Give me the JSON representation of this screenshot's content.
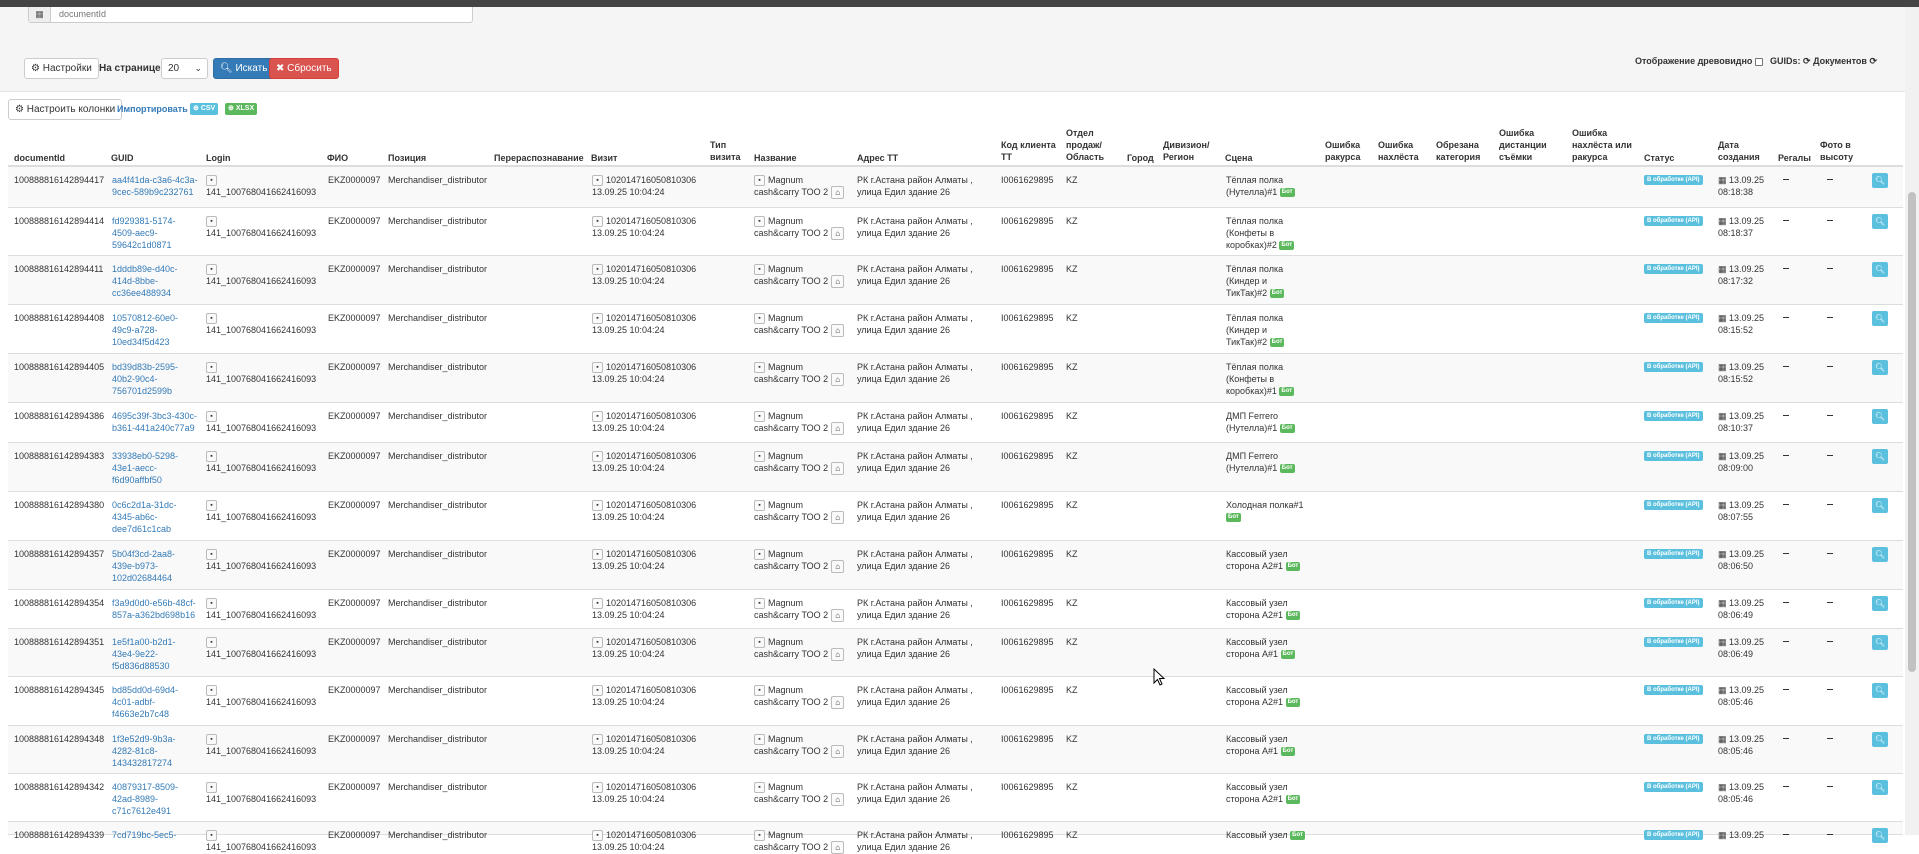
{
  "filters": {
    "document_id_placeholder": "documentId",
    "settings_label": "Настройки",
    "per_page_label": "На странице:",
    "per_page_value": "20",
    "search_label": "Искать",
    "reset_label": "Сбросить",
    "tree_view_label": "Отображение древовидно",
    "guids_label": "GUIDs:",
    "documents_label": "Документов"
  },
  "toolbar": {
    "configure_columns_label": "Настроить колонки",
    "import_label": "Импортировать",
    "csv_label": "CSV",
    "xlsx_label": "XLSX"
  },
  "columns": {
    "documentId": "documentId",
    "guid": "GUID",
    "login": "Login",
    "fio": "ФИО",
    "position": "Позиция",
    "rerecog": "Перераспознавание",
    "visit": "Визит",
    "visit_type": "Тип визита",
    "name": "Название",
    "address": "Адрес ТТ",
    "client_code": "Код клиента ТТ",
    "sales_dept": "Отдел продаж/ Область",
    "city": "Город",
    "division": "Дивизион/ Регион",
    "scene": "Сцена",
    "angle_error": "Ошибка ракурса",
    "overlap_error": "Ошибка нахлёста",
    "cut_category": "Обрезана категория",
    "distance_error": "Ошибка дистанции съёмки",
    "overlap_angle_error": "Ошибка нахлёста или ракурса",
    "status": "Статус",
    "created": "Дата создания",
    "shelves": "Регалы",
    "height_photo": "Фото в высоту"
  },
  "common": {
    "login": "141_100768041662416093",
    "fio": "EKZ0000097",
    "position": "Merchandiser_distributor",
    "visit_id": "102014716050810306",
    "visit_date": "13.09.25 10:04:24",
    "name_line1": "Magnum",
    "name_line2": "cash&carry ТОО 2",
    "address_line1": "РК г.Астана район Алматы ,",
    "address_line2": "улица Едил здание 26",
    "client_code": "I0061629895",
    "region": "KZ",
    "status": "В обработке (API)",
    "tag": "Бот"
  },
  "rows": [
    {
      "id": "100888816142894417",
      "guid": [
        "aa4f41da-c3a6-4c3a-",
        "9cec-589b9c232761"
      ],
      "scene": [
        "Тёплая полка",
        "(Нутелла)#1"
      ],
      "date": "13.09.25",
      "time": "08:18:38"
    },
    {
      "id": "100888816142894414",
      "guid": [
        "fd929381-5174-",
        "4509-aec9-",
        "59642c1d0871"
      ],
      "scene": [
        "Тёплая полка",
        "(Конфеты в",
        "коробках)#2"
      ],
      "date": "13.09.25",
      "time": "08:18:37"
    },
    {
      "id": "100888816142894411",
      "guid": [
        "1dddb89e-d40c-",
        "414d-8bbe-",
        "cc36ee488934"
      ],
      "scene": [
        "Тёплая полка",
        "(Киндер и",
        "ТикТак)#2"
      ],
      "date": "13.09.25",
      "time": "08:17:32"
    },
    {
      "id": "100888816142894408",
      "guid": [
        "10570812-60e0-",
        "49c9-a728-",
        "10ed34f5d423"
      ],
      "scene": [
        "Тёплая полка",
        "(Киндер и",
        "ТикТак)#2"
      ],
      "date": "13.09.25",
      "time": "08:15:52"
    },
    {
      "id": "100888816142894405",
      "guid": [
        "bd39d83b-2595-",
        "40b2-90c4-",
        "756701d2599b"
      ],
      "scene": [
        "Тёплая полка",
        "(Конфеты в",
        "коробках)#1"
      ],
      "date": "13.09.25",
      "time": "08:15:52"
    },
    {
      "id": "100888816142894386",
      "guid": [
        "4695c39f-3bc3-430c-",
        "b361-441a240c77a9"
      ],
      "scene": [
        "ДМП Ferrero",
        "(Нутелла)#1"
      ],
      "date": "13.09.25",
      "time": "08:10:37"
    },
    {
      "id": "100888816142894383",
      "guid": [
        "33938eb0-5298-",
        "43e1-aecc-",
        "f6d90affbf50"
      ],
      "scene": [
        "ДМП Ferrero",
        "(Нутелла)#1"
      ],
      "date": "13.09.25",
      "time": "08:09:00"
    },
    {
      "id": "100888816142894380",
      "guid": [
        "0c6c2d1a-31dc-",
        "4345-ab6c-",
        "dee7d61c1cab"
      ],
      "scene": [
        "Холодная полка#1"
      ],
      "date": "13.09.25",
      "time": "08:07:55"
    },
    {
      "id": "100888816142894357",
      "guid": [
        "5b04f3cd-2aa8-",
        "439e-b973-",
        "102d02684464"
      ],
      "scene": [
        "Кассовый узел",
        "сторона A2#1"
      ],
      "date": "13.09.25",
      "time": "08:06:50"
    },
    {
      "id": "100888816142894354",
      "guid": [
        "f3a9d0d0-e56b-48cf-",
        "857a-a362bd698b16"
      ],
      "scene": [
        "Кассовый узел",
        "сторона A2#1"
      ],
      "date": "13.09.25",
      "time": "08:06:49"
    },
    {
      "id": "100888816142894351",
      "guid": [
        "1e5f1a00-b2d1-",
        "43e4-9e22-",
        "f5d836d88530"
      ],
      "scene": [
        "Кассовый узел",
        "сторона A#1"
      ],
      "date": "13.09.25",
      "time": "08:06:49"
    },
    {
      "id": "100888816142894345",
      "guid": [
        "bd85dd0d-69d4-",
        "4c01-adbf-",
        "f4663e2b7c48"
      ],
      "scene": [
        "Кассовый узел",
        "сторона A2#1"
      ],
      "date": "13.09.25",
      "time": "08:05:46"
    },
    {
      "id": "100888816142894348",
      "guid": [
        "1f3e52d9-9b3a-",
        "4282-81c8-",
        "143432817274"
      ],
      "scene": [
        "Кассовый узел",
        "сторона A#1"
      ],
      "date": "13.09.25",
      "time": "08:05:46"
    },
    {
      "id": "100888816142894342",
      "guid": [
        "40879317-8509-",
        "42ad-8989-",
        "c71c7612e491"
      ],
      "scene": [
        "Кассовый узел",
        "сторона A2#1"
      ],
      "date": "13.09.25",
      "time": "08:05:46"
    },
    {
      "id": "100888816142894339",
      "guid": [
        "7cd719bc-5ec5-"
      ],
      "scene": [
        "Кассовый узел"
      ],
      "date": "13.09.25",
      "time": ""
    }
  ]
}
